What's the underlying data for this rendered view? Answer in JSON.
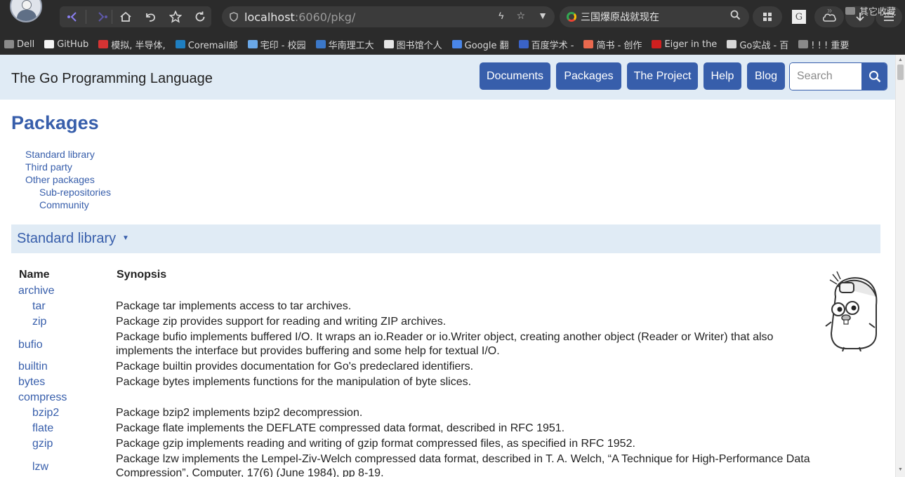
{
  "browser": {
    "url_host": "localhost",
    "url_rest": ":6060/pkg/",
    "search_query": "三国爆原战就现在",
    "extension_letter": "G",
    "bookmarks": [
      {
        "label": "Dell",
        "color": "#8a8a8a",
        "icon": "folder-icon"
      },
      {
        "label": "GitHub",
        "color": "#f5f5f5",
        "icon": "github-icon"
      },
      {
        "label": "模拟, 半导体,",
        "color": "#d63333",
        "icon": "chip-icon"
      },
      {
        "label": "Coremail邮",
        "color": "#1f7fc1",
        "icon": "coremail-icon"
      },
      {
        "label": "宅印 - 校园",
        "color": "#6aa8e8",
        "icon": "cloud-icon"
      },
      {
        "label": "华南理工大",
        "color": "#3b78c9",
        "icon": "school-icon"
      },
      {
        "label": "图书馆个人",
        "color": "#e6e6e6",
        "icon": "page-icon"
      },
      {
        "label": "Google 翻",
        "color": "#4a86e8",
        "icon": "translate-icon"
      },
      {
        "label": "百度学术 -",
        "color": "#3a63c8",
        "icon": "baidu-icon"
      },
      {
        "label": "简书 - 创作",
        "color": "#e9694e",
        "icon": "jianshu-icon"
      },
      {
        "label": "Eiger in the",
        "color": "#d0201f",
        "icon": "eiger-icon"
      },
      {
        "label": "Go实战 - 百",
        "color": "#d8d8d8",
        "icon": "glasses-icon"
      },
      {
        "label": "! ! ! 重要",
        "color": "#8a8a8a",
        "icon": "folder-icon"
      }
    ],
    "other_bookmarks": "其它收藏"
  },
  "site": {
    "title": "The Go Programming Language",
    "nav": [
      "Documents",
      "Packages",
      "The Project",
      "Help",
      "Blog"
    ],
    "search_placeholder": "Search"
  },
  "page": {
    "heading": "Packages",
    "toc": {
      "standard": "Standard library",
      "third": "Third party",
      "other": "Other packages",
      "subrepos": "Sub-repositories",
      "community": "Community"
    },
    "section_title": "Standard library",
    "col_name": "Name",
    "col_synopsis": "Synopsis",
    "packages": [
      {
        "name": "archive",
        "synopsis": "",
        "indent": 0
      },
      {
        "name": "tar",
        "synopsis": "Package tar implements access to tar archives.",
        "indent": 1
      },
      {
        "name": "zip",
        "synopsis": "Package zip provides support for reading and writing ZIP archives.",
        "indent": 1
      },
      {
        "name": "bufio",
        "synopsis": "Package bufio implements buffered I/O. It wraps an io.Reader or io.Writer object, creating another object (Reader or Writer) that also implements the interface but provides buffering and some help for textual I/O.",
        "indent": 0
      },
      {
        "name": "builtin",
        "synopsis": "Package builtin provides documentation for Go's predeclared identifiers.",
        "indent": 0
      },
      {
        "name": "bytes",
        "synopsis": "Package bytes implements functions for the manipulation of byte slices.",
        "indent": 0
      },
      {
        "name": "compress",
        "synopsis": "",
        "indent": 0
      },
      {
        "name": "bzip2",
        "synopsis": "Package bzip2 implements bzip2 decompression.",
        "indent": 1
      },
      {
        "name": "flate",
        "synopsis": "Package flate implements the DEFLATE compressed data format, described in RFC 1951.",
        "indent": 1
      },
      {
        "name": "gzip",
        "synopsis": "Package gzip implements reading and writing of gzip format compressed files, as specified in RFC 1952.",
        "indent": 1
      },
      {
        "name": "lzw",
        "synopsis": "Package lzw implements the Lempel-Ziv-Welch compressed data format, described in T. A. Welch, “A Technique for High-Performance Data Compression”, Computer, 17(6) (June 1984), pp 8-19.",
        "indent": 1
      }
    ]
  }
}
